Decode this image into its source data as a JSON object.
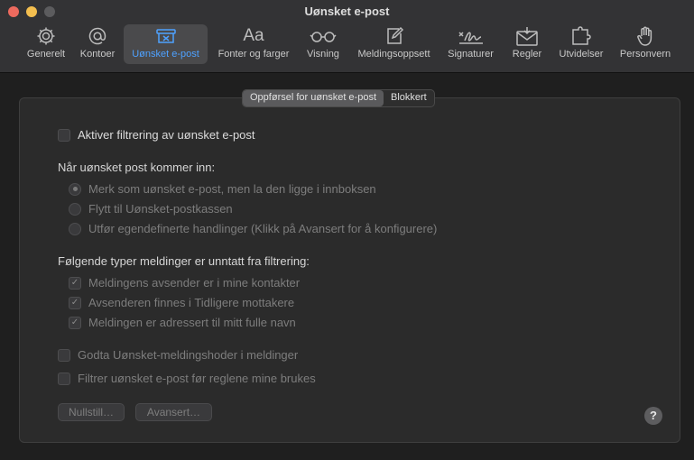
{
  "window": {
    "title": "Uønsket e-post"
  },
  "toolbar": {
    "items": [
      {
        "label": "Generelt",
        "icon": "gear-icon"
      },
      {
        "label": "Kontoer",
        "icon": "at-sign-icon"
      },
      {
        "label": "Uønsket e-post",
        "icon": "junk-tray-icon",
        "selected": true
      },
      {
        "label": "Fonter og farger",
        "icon": "font-icon"
      },
      {
        "label": "Visning",
        "icon": "glasses-icon"
      },
      {
        "label": "Meldingsoppsett",
        "icon": "compose-icon"
      },
      {
        "label": "Signaturer",
        "icon": "signature-icon"
      },
      {
        "label": "Regler",
        "icon": "envelope-rules-icon"
      },
      {
        "label": "Utvidelser",
        "icon": "puzzle-icon"
      },
      {
        "label": "Personvern",
        "icon": "hand-icon"
      }
    ]
  },
  "tabs": {
    "behavior": "Oppførsel for uønsket e-post",
    "blocked": "Blokkert"
  },
  "settings": {
    "enable_filtering": "Aktiver filtrering av uønsket e-post",
    "when_arrives_heading": "Når uønsket post kommer inn:",
    "radio_mark": "Merk som uønsket e-post, men la den ligge i innboksen",
    "radio_move": "Flytt til Uønsket-postkassen",
    "radio_custom": "Utfør egendefinerte handlinger (Klikk på Avansert for å konfigurere)",
    "exempt_heading": "Følgende typer meldinger er unntatt fra filtrering:",
    "exempt_contacts": "Meldingens avsender er i mine kontakter",
    "exempt_previous": "Avsenderen finnes i Tidligere mottakere",
    "exempt_fullname": "Meldingen er adressert til mitt fulle navn",
    "trust_headers": "Godta Uønsket-meldingshoder i meldinger",
    "filter_before_rules": "Filtrer uønsket e-post før reglene mine brukes"
  },
  "buttons": {
    "reset": "Nullstill…",
    "advanced": "Avansert…",
    "help": "?"
  },
  "checkmark": "✓"
}
